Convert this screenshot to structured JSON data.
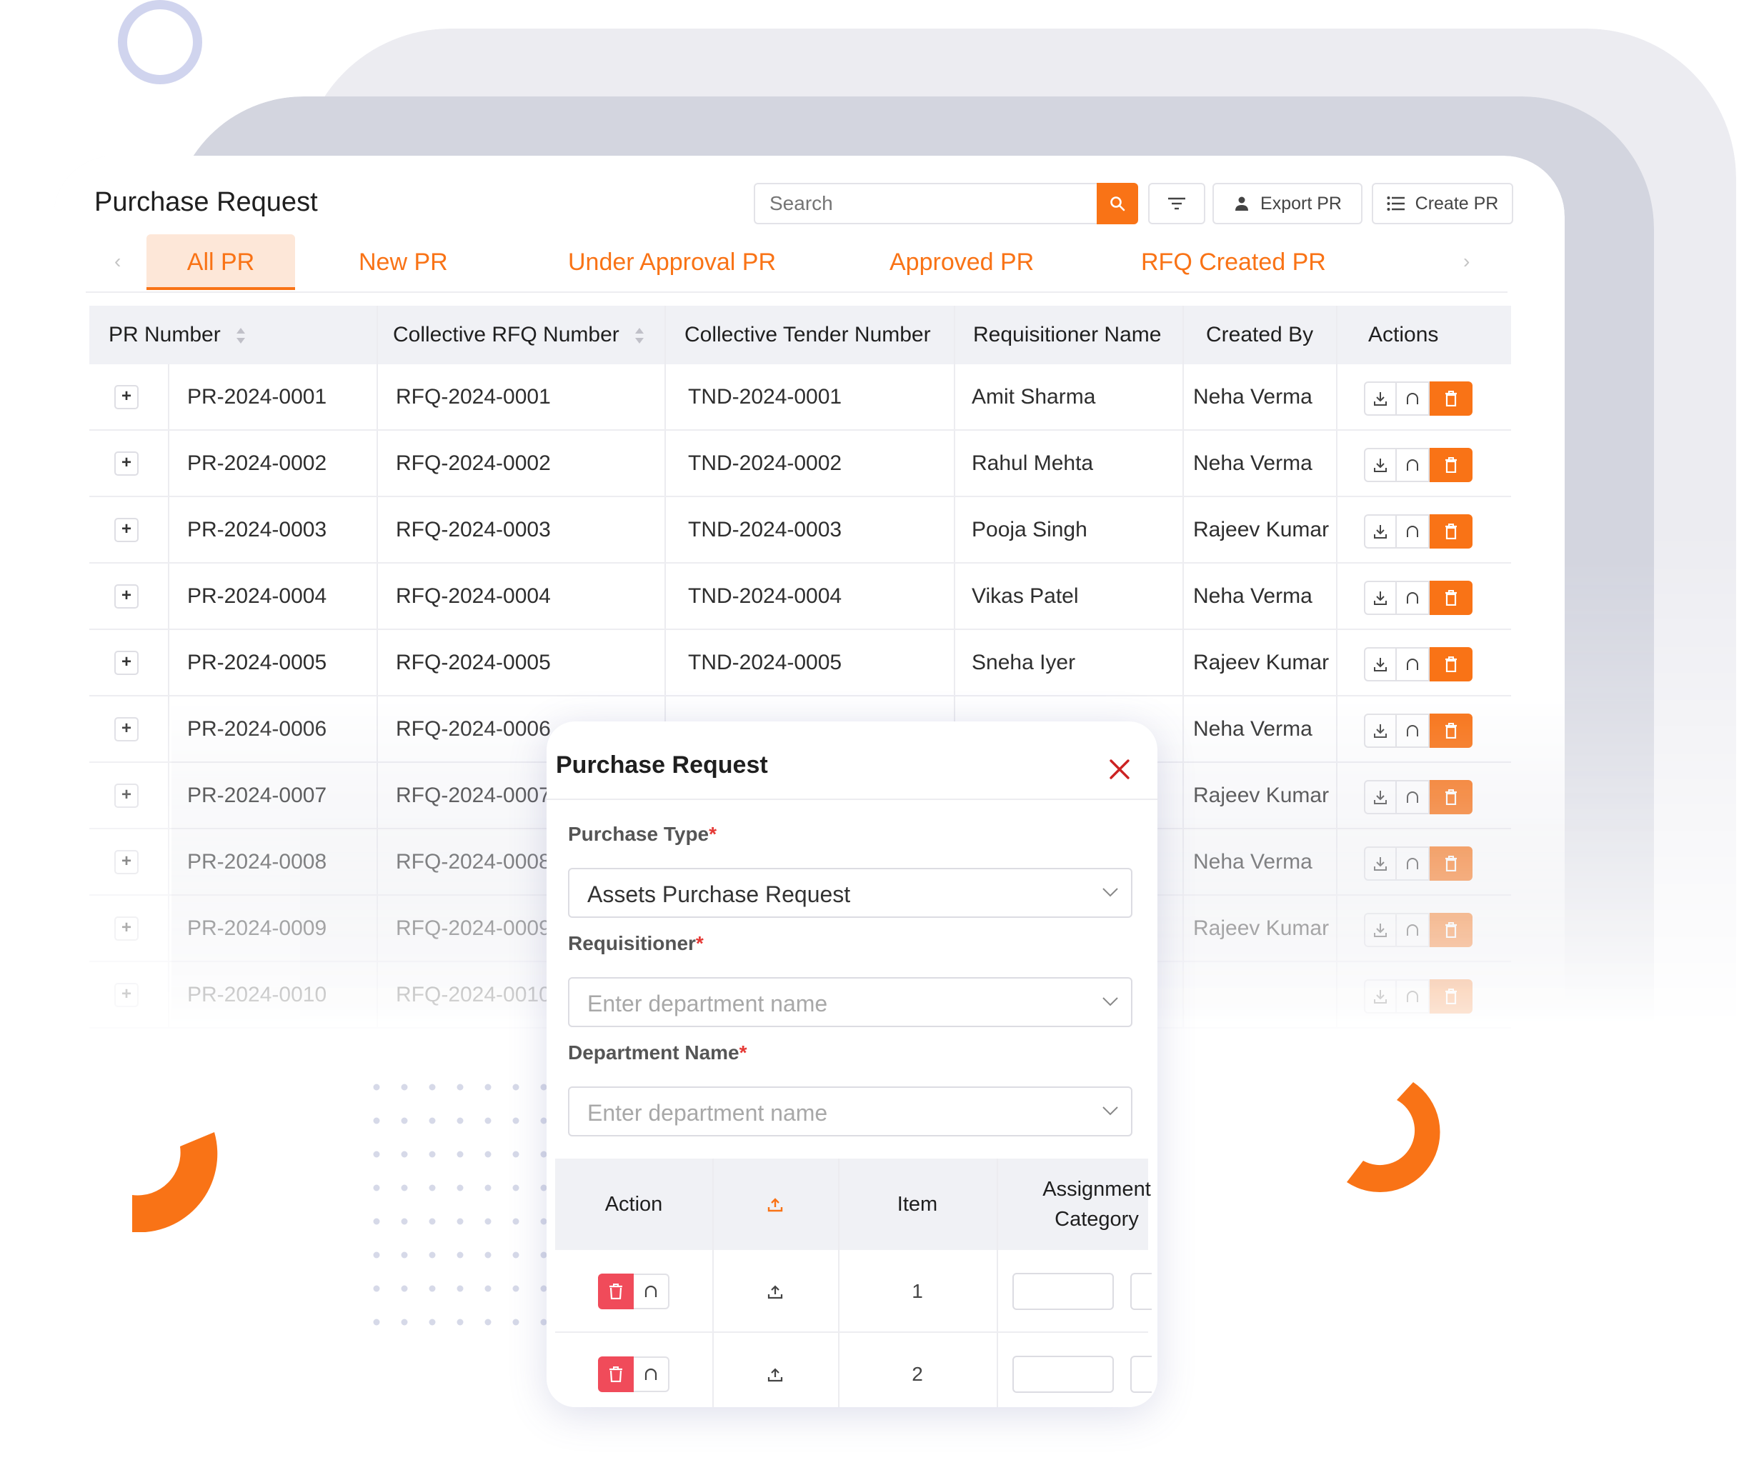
{
  "page": {
    "title": "Purchase Request",
    "search_placeholder": "Search",
    "export_label": "Export PR",
    "create_label": "Create PR"
  },
  "tabs": [
    {
      "label": "All PR",
      "active": true
    },
    {
      "label": "New PR"
    },
    {
      "label": "Under Approval PR"
    },
    {
      "label": "Approved PR"
    },
    {
      "label": "RFQ Created PR"
    }
  ],
  "table": {
    "columns": [
      "PR Number",
      "Collective RFQ Number",
      "Collective Tender Number",
      "Requisitioner Name",
      "Created By",
      "Actions"
    ],
    "rows": [
      {
        "pr": "PR-2024-0001",
        "rfq": "RFQ-2024-0001",
        "tnd": "TND-2024-0001",
        "req": "Amit Sharma",
        "by": "Neha Verma"
      },
      {
        "pr": "PR-2024-0002",
        "rfq": "RFQ-2024-0002",
        "tnd": "TND-2024-0002",
        "req": "Rahul Mehta",
        "by": "Neha Verma"
      },
      {
        "pr": "PR-2024-0003",
        "rfq": "RFQ-2024-0003",
        "tnd": "TND-2024-0003",
        "req": "Pooja Singh",
        "by": "Rajeev Kumar"
      },
      {
        "pr": "PR-2024-0004",
        "rfq": "RFQ-2024-0004",
        "tnd": "TND-2024-0004",
        "req": "Vikas Patel",
        "by": "Neha Verma"
      },
      {
        "pr": "PR-2024-0005",
        "rfq": "RFQ-2024-0005",
        "tnd": "TND-2024-0005",
        "req": "Sneha Iyer",
        "by": "Rajeev Kumar"
      },
      {
        "pr": "PR-2024-0006",
        "rfq": "RFQ-2024-0006",
        "tnd": "",
        "req": "",
        "by": "Neha Verma"
      },
      {
        "pr": "PR-2024-0007",
        "rfq": "RFQ-2024-0007",
        "tnd": "",
        "req": "",
        "by": "Rajeev Kumar"
      },
      {
        "pr": "PR-2024-0008",
        "rfq": "RFQ-2024-0008",
        "tnd": "",
        "req": "",
        "by": "Neha Verma"
      },
      {
        "pr": "PR-2024-0009",
        "rfq": "RFQ-2024-0009",
        "tnd": "",
        "req": "",
        "by": "Rajeev Kumar"
      },
      {
        "pr": "PR-2024-0010",
        "rfq": "RFQ-2024-0010",
        "tnd": "",
        "req": "",
        "by": ""
      }
    ]
  },
  "modal": {
    "title": "Purchase Request",
    "purchase_type_label": "Purchase Type",
    "purchase_type_value": "Assets Purchase Request",
    "requisitioner_label": "Requisitioner",
    "requisitioner_placeholder": "Enter department name",
    "department_label": "Department Name",
    "department_placeholder": "Enter department name",
    "required_mark": "*",
    "items_table": {
      "columns": [
        "Action",
        "",
        "Item",
        "Assignment Category"
      ],
      "rows": [
        {
          "item": "1"
        },
        {
          "item": "2"
        }
      ]
    }
  },
  "icons": [
    "search-icon",
    "filter-icon",
    "export-icon",
    "list-icon",
    "sort-icon",
    "plus-icon",
    "download-icon",
    "reset-icon",
    "trash-icon",
    "close-icon",
    "chevron-down-icon",
    "upload-icon",
    "chevron-left-icon",
    "chevron-right-icon"
  ],
  "colors": {
    "accent": "#f97316",
    "accent_light": "#fde7d8",
    "danger": "#f04b5a",
    "close": "#cc2222"
  }
}
